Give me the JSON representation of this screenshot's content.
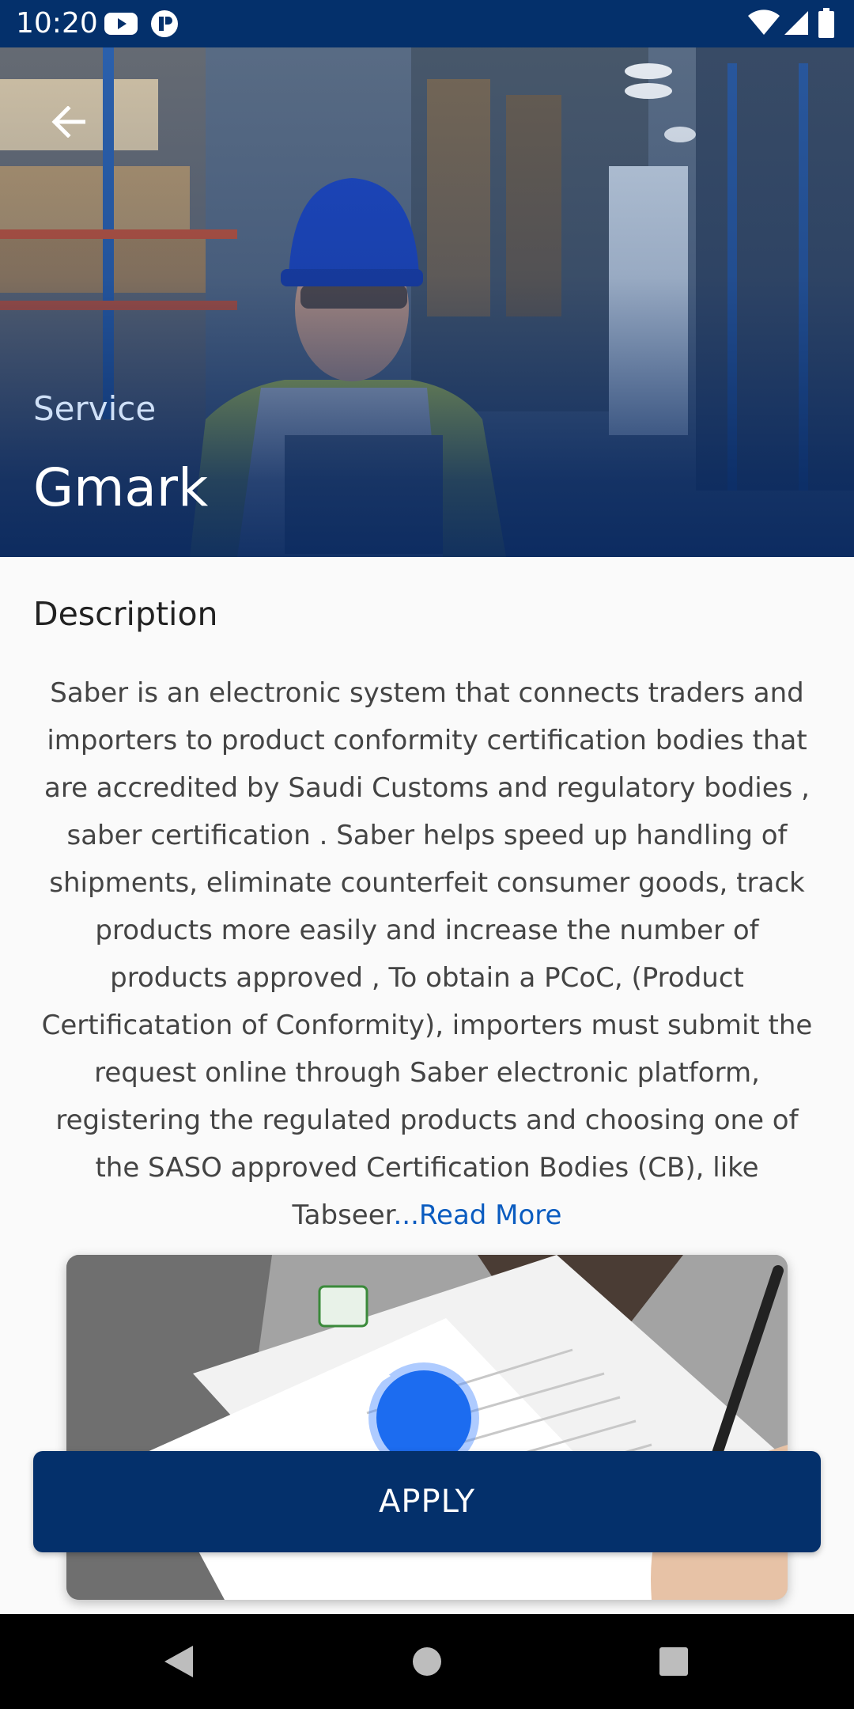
{
  "status_bar": {
    "time": "10:20",
    "icons": [
      "youtube-icon",
      "app-notification-icon",
      "wifi-icon",
      "signal-icon",
      "battery-icon"
    ]
  },
  "hero": {
    "caption": "Service",
    "title": "Gmark",
    "back_icon": "arrow-left-icon"
  },
  "description": {
    "heading": "Description",
    "body": "Saber is an electronic system that connects traders and importers to product conformity certification bodies that are accredited by Saudi Customs and regulatory bodies , saber certification . Saber helps speed up handling of shipments, eliminate counterfeit consumer goods, track products more easily and increase the number of products approved , To obtain a PCoC, (Product Certificatation of Conformity), importers must submit the request online through Saber electronic platform, registering the regulated products and choosing one of the SASO approved Certification Bodies (CB), like Tabseer",
    "read_more": "...Read More"
  },
  "video": {
    "play_icon": "play-icon"
  },
  "apply_button": {
    "label": "APPLY"
  },
  "nav_bar": {
    "icons": [
      "back-triangle-icon",
      "home-circle-icon",
      "recents-square-icon"
    ]
  },
  "colors": {
    "primary": "#04306b",
    "link": "#0b5cc0",
    "play": "#1c6cf0"
  }
}
